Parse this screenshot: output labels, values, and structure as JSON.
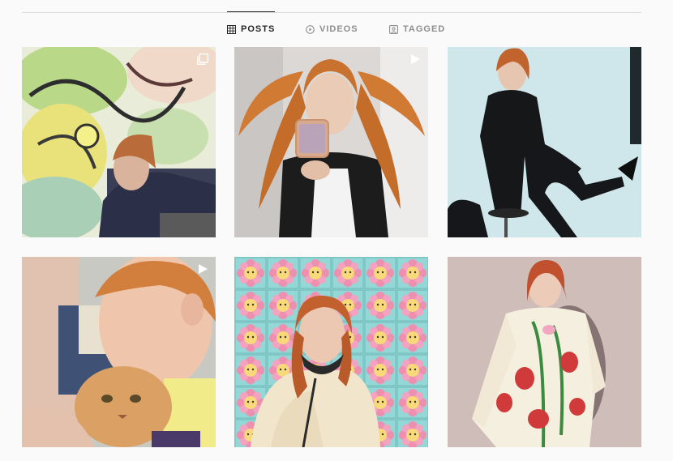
{
  "tabs": [
    {
      "label": "POSTS",
      "icon": "grid-icon",
      "active": true
    },
    {
      "label": "VIDEOS",
      "icon": "play-circle-icon",
      "active": false
    },
    {
      "label": "TAGGED",
      "icon": "tagged-icon",
      "active": false
    }
  ],
  "posts": [
    {
      "description": "Person crouching in front of a colorful graffiti mural",
      "badge": "carousel-icon"
    },
    {
      "description": "Person with long orange pigtails taking a mirror selfie with a flip phone",
      "badge": "video-icon"
    },
    {
      "description": "Person in a black suit sitting on a stool against a pale blue backdrop",
      "badge": ""
    },
    {
      "description": "Person hugging an orange cat",
      "badge": "video-icon"
    },
    {
      "description": "Person in front of a wall of pixel flower tiles",
      "badge": ""
    },
    {
      "description": "Person in a white knit dress with red flower pattern",
      "badge": ""
    }
  ]
}
